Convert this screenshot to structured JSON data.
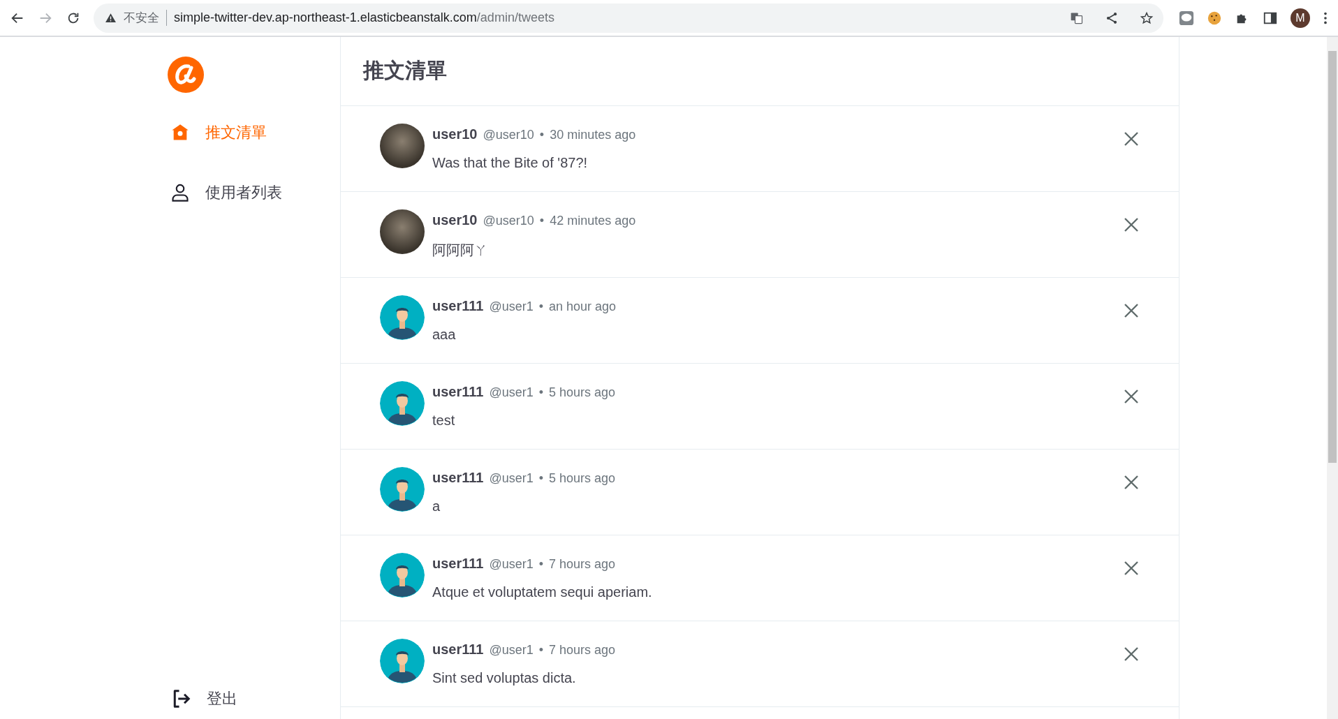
{
  "browser": {
    "security_label": "不安全",
    "url_host": "simple-twitter-dev.ap-northeast-1.elasticbeanstalk.com",
    "url_path": "/admin/tweets",
    "profile_initial": "M"
  },
  "sidebar": {
    "items": [
      {
        "label": "推文清單",
        "kind": "home",
        "selected": true
      },
      {
        "label": "使用者列表",
        "kind": "user",
        "selected": false
      }
    ],
    "logout": {
      "label": "登出"
    }
  },
  "main": {
    "title": "推文清單",
    "tweets": [
      {
        "name": "user10",
        "account": "@user10",
        "separator": "•",
        "time": "30 minutes ago",
        "text": "Was that the Bite of '87?!",
        "kind": "photo"
      },
      {
        "name": "user10",
        "account": "@user10",
        "separator": "•",
        "time": "42 minutes ago",
        "text": "阿阿阿ㄚ",
        "kind": "photo"
      },
      {
        "name": "user111",
        "account": "@user1",
        "separator": "•",
        "time": "an hour ago",
        "text": "aaa",
        "kind": "default"
      },
      {
        "name": "user111",
        "account": "@user1",
        "separator": "•",
        "time": "5 hours ago",
        "text": "test",
        "kind": "default"
      },
      {
        "name": "user111",
        "account": "@user1",
        "separator": "•",
        "time": "5 hours ago",
        "text": "a",
        "kind": "default"
      },
      {
        "name": "user111",
        "account": "@user1",
        "separator": "•",
        "time": "7 hours ago",
        "text": "Atque et voluptatem sequi aperiam.",
        "kind": "default"
      },
      {
        "name": "user111",
        "account": "@user1",
        "separator": "•",
        "time": "7 hours ago",
        "text": "Sint sed voluptas dicta.",
        "kind": "default"
      }
    ]
  }
}
